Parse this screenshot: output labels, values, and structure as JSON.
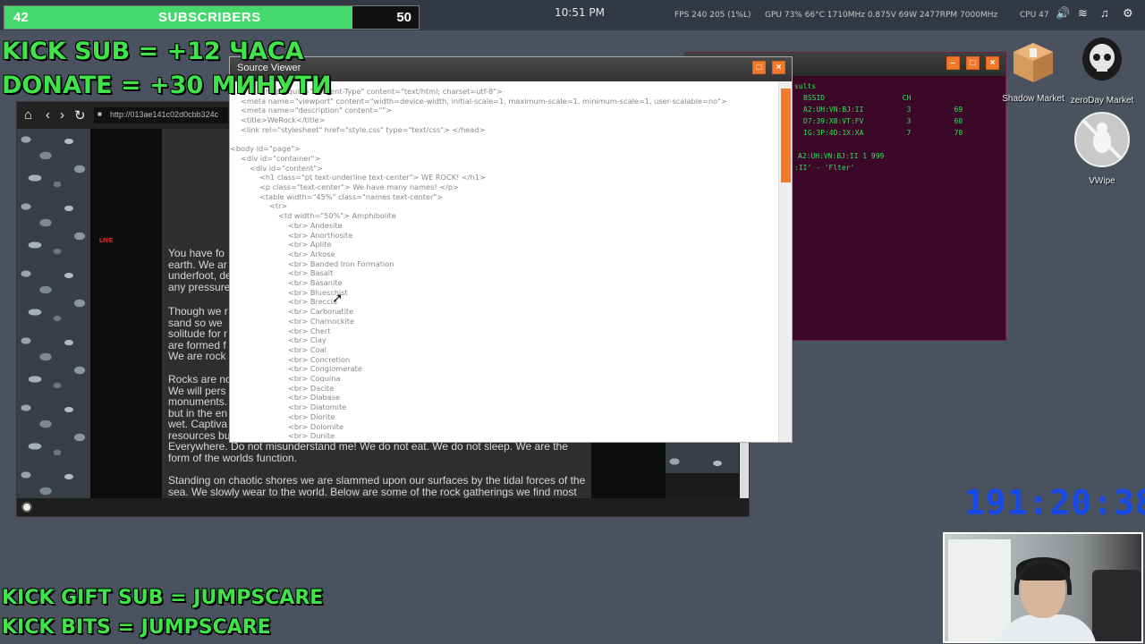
{
  "topbar": {
    "subs_current": "42",
    "subs_label": "SUBSCRIBERS",
    "subs_goal": "50",
    "subs_progress": 0.84,
    "clock": "10:51 PM",
    "stats": "FPS 240  205 (1%L)",
    "stats2": "GPU 73% 66°C 1710MHz 0.875V 69W 2477RPM 7000MHz",
    "cpu": "CPU 47"
  },
  "overlays": {
    "kick_sub": "KICK SUB = +12 ЧАСА",
    "donate": "DONATE = +30 МИНУТИ",
    "gift_sub": "KICK GIFT SUB = JUMPSCARE",
    "bits": "KICK BITS = JUMPSCARE"
  },
  "browser": {
    "url": "http://013ae141c02d0cbb324c",
    "live": "LIVE",
    "paragraphs": [
      "You have fo\nearth. We ar\nunderfoot, de\nany pressure",
      "Though we r\nsand so we \nsolitude for r\nare formed f\nWe are rock",
      "Rocks are no\nWe will pers\nmonuments.\nbut in the en\nwet. Captiva\nresources bu\nEverywhere. Do not misunderstand me! We do not eat. We do not sleep. We are the\nform of the worlds function.",
      "Standing on chaotic shores we are slammed upon our surfaces by the tidal forces of the\nsea. We slowly wear to the world. Below are some of the rock gatherings we find most"
    ]
  },
  "source_viewer": {
    "title": "Source Viewer",
    "lines": [
      "http-equiv=\"Content-Type\" content=\"text/html; charset=utf-8\">",
      "<meta name=\"viewport\" content=\"width=device-width, initial-scale=1, maximum-scale=1, minimum-scale=1, user-scalable=no\">",
      "<meta name=\"description\" content=\"\">",
      "<title>WeRock</title>",
      "<link rel=\"stylesheet\" href=\"style.css\" type=\"text/css\"> </head>",
      "",
      "<body id=\"page\">",
      "<div id=\"container\">",
      "<div id=\"content\">",
      "<h1 class=\"pt text-underline text-center\"> WE ROCK! </h1>",
      "<p class=\"text-center\"> We have many names! </p>",
      "<table width=\"45%\" class=\"names text-center\">",
      "<tr>",
      "<td width=\"50%\"> Amphibolite",
      "<br> Andesite",
      "<br> Anorthosite",
      "<br> Aplite",
      "<br> Arkose",
      "<br> Banded Iron Formation",
      "<br> Basalt",
      "<br> Basanite",
      "<br> Blueschist",
      "<br> Breccia",
      "<br> Carbonatite",
      "<br> Charnockite",
      "<br> Chert",
      "<br> Clay",
      "<br> Coal",
      "<br> Concretion",
      "<br> Conglomerate",
      "<br> Coquina",
      "<br> Dacite",
      "<br> Diabase",
      "<br> Diatomite",
      "<br> Diorite",
      "<br> Dolomite",
      "<br> Dunite"
    ]
  },
  "terminal": {
    "lines": [
      "sults",
      "BSSID                  CH",
      "A2:UH:VN:BJ:II          3          69",
      "D7:39:XB:VT:FV          3          60",
      "IG:3P:4D:1X:XA          7          70",
      "",
      "A2:UH:VN:BJ:II 1 999",
      ":II' - 'Flter'"
    ]
  },
  "desktop": {
    "icons": [
      {
        "label": "Shadow Market",
        "icon": "package-icon"
      },
      {
        "label": "zeroDay Market",
        "icon": "skull-icon"
      },
      {
        "label": "VWipe",
        "icon": "bug-icon"
      }
    ]
  },
  "timer": "191:20:38",
  "colors": {
    "overlay_green": "#3fe44a",
    "progress_green": "#45d86c",
    "timer_blue": "#1649e8",
    "accent_orange": "#f07a2a",
    "terminal_green": "#2ee05a",
    "terminal_bg": "#3c0828"
  }
}
